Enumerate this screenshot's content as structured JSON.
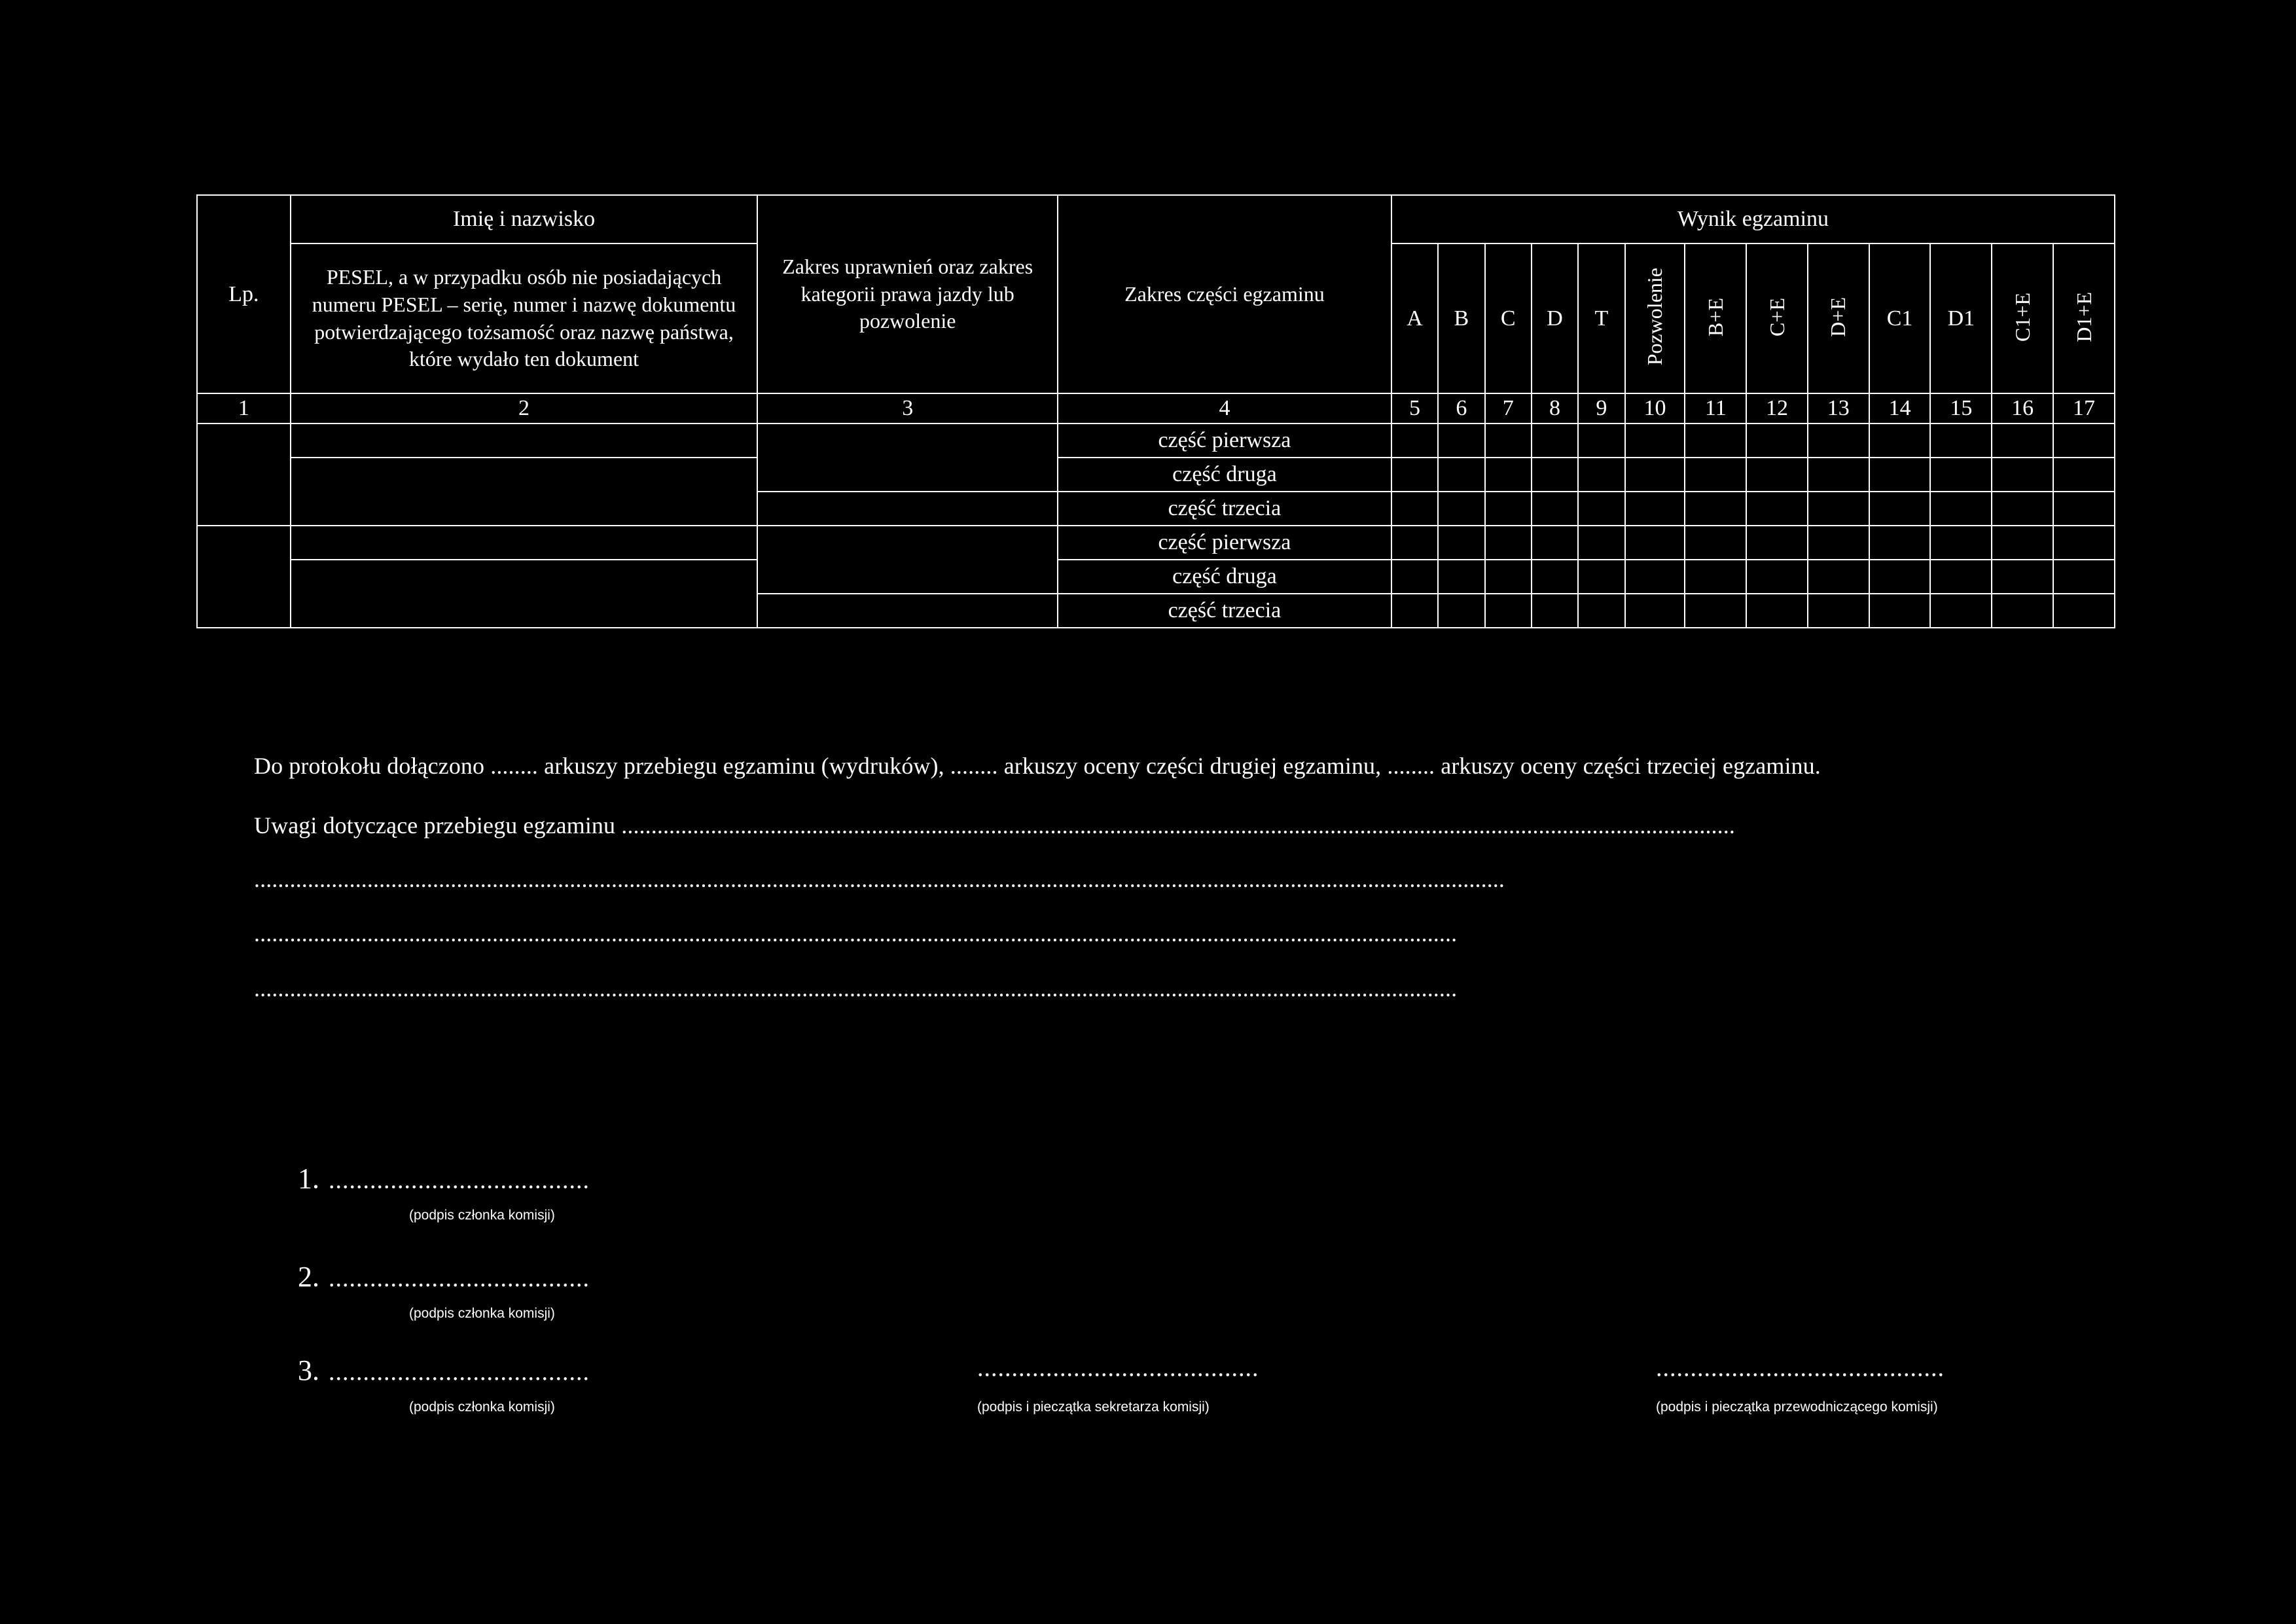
{
  "table": {
    "headers": {
      "lp": "Lp.",
      "name_top": "Imię i nazwisko",
      "name_bottom": "PESEL, a w przypadku osób nie posiadających numeru PESEL – serię, numer i nazwę dokumentu potwierdzającego tożsamość oraz nazwę państwa, które wydało ten dokument",
      "scope_rights": "Zakres uprawnień oraz zakres kategorii prawa jazdy lub pozwolenie",
      "exam_scope": "Zakres części egzaminu",
      "result_group": "Wynik egzaminu",
      "result_cols": [
        "A",
        "B",
        "C",
        "D",
        "T",
        "Pozwolenie",
        "B+E",
        "C+E",
        "D+E",
        "C1",
        "D1",
        "C1+E",
        "D1+E"
      ]
    },
    "column_numbers": [
      "1",
      "2",
      "3",
      "4",
      "5",
      "6",
      "7",
      "8",
      "9",
      "10",
      "11",
      "12",
      "13",
      "14",
      "15",
      "16",
      "17"
    ],
    "part_labels": [
      "część pierwsza",
      "część druga",
      "część trzecia"
    ],
    "row_groups": 2
  },
  "body": {
    "attached_line": "Do protokołu dołączono  ........ arkuszy przebiegu egzaminu (wydruków), ........ arkuszy oceny części drugiej egzaminu, ........ arkuszy oceny części trzeciej egzaminu.",
    "notes_label": "Uwagi dotyczące przebiegu egzaminu",
    "notes_dots_1": "...........................................................................................................................................................................................",
    "notes_dots_2": "..................................................................................................................................................................................................................",
    "notes_dots_3": "..........................................................................................................................................................................................................",
    "notes_dots_4": ".........................................................................................................................................................................................................."
  },
  "signatures": {
    "dots": "......................................",
    "items": [
      {
        "number": "1.",
        "caption": "(podpis  członka komisji)"
      },
      {
        "number": "2.",
        "caption": "(podpis członka komisji)"
      },
      {
        "number": "3.",
        "caption": "(podpis członka komisji)"
      }
    ],
    "secretary": {
      "dots": ".........................................",
      "caption": "(podpis i pieczątka sekretarza komisji)"
    },
    "chairman": {
      "dots": "..........................................",
      "caption": "(podpis i pieczątka przewodniczącego komisji)"
    }
  },
  "colors": {
    "background": "#000000",
    "foreground": "#ffffff"
  }
}
